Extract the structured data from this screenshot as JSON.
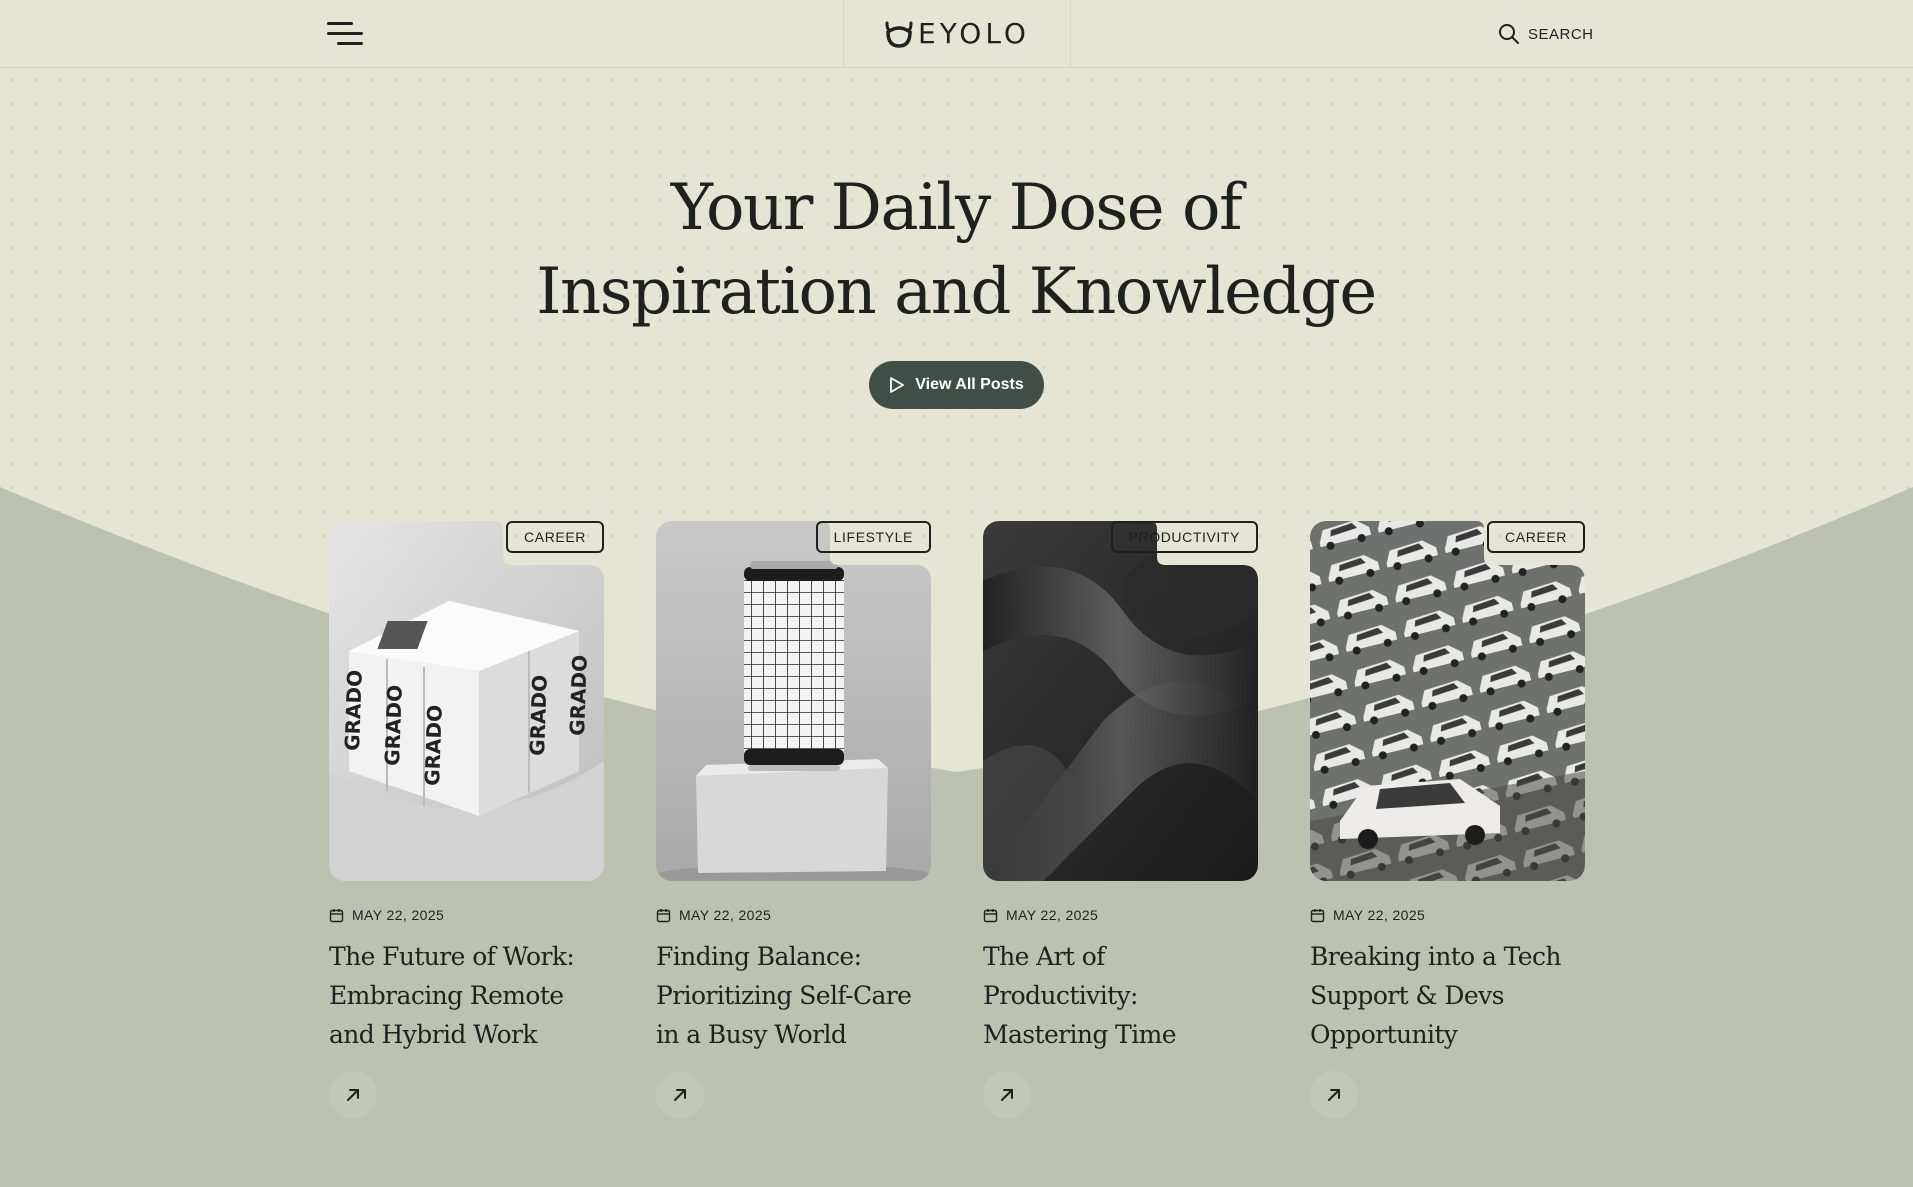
{
  "brand": {
    "name": "EYOLO"
  },
  "header": {
    "search_label": "SEARCH"
  },
  "hero": {
    "title_line1": "Your Daily Dose of",
    "title_line2": "Inspiration and Knowledge",
    "cta_label": "View All Posts"
  },
  "colors": {
    "background": "#e6e5d4",
    "wave": "#bcc2b0",
    "accent": "#3f4e46",
    "text": "#1f211e"
  },
  "posts": [
    {
      "category": "CAREER",
      "date": "MAY 22, 2025",
      "title": "The Future of Work: Embracing Remote and Hybrid Work Models",
      "image": "white-product-boxes-grado"
    },
    {
      "category": "LIFESTYLE",
      "date": "MAY 22, 2025",
      "title": "Finding Balance: Prioritizing Self-Care in a Busy World",
      "image": "grid-pattern-can-on-stone"
    },
    {
      "category": "PRODUCTIVITY",
      "date": "MAY 22, 2025",
      "title": "The Art of Productivity: Mastering Time Management and Goa...",
      "image": "dark-abstract-waves"
    },
    {
      "category": "CAREER",
      "date": "MAY 22, 2025",
      "title": "Breaking into a Tech Support & Devs Opportunity",
      "image": "rows-of-white-sports-cars"
    }
  ]
}
